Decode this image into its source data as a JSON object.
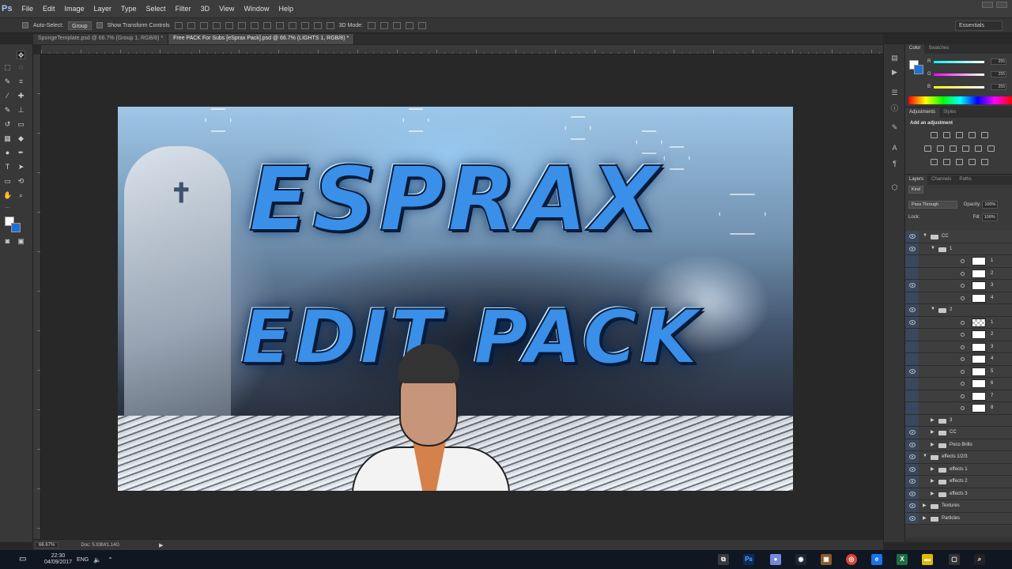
{
  "app": {
    "logo": "Ps",
    "menu": [
      "File",
      "Edit",
      "Image",
      "Layer",
      "Type",
      "Select",
      "Filter",
      "3D",
      "View",
      "Window",
      "Help"
    ],
    "workspace": "Essentials"
  },
  "options": {
    "auto_select_label": "Auto-Select:",
    "auto_select_value": "Group",
    "transform_label": "Show Transform Controls",
    "mode_3d": "3D Mode:"
  },
  "tabs": [
    {
      "label": "SpongeTemplate.psd @ 66.7% (Group 1, RGB/8) *",
      "active": false
    },
    {
      "label": "Free PACK For Subs [eSprax Pack].psd @ 66.7% (LIGHTS 1, RGB/8) *",
      "active": true
    }
  ],
  "artwork": {
    "title_line1": "ESPRAX",
    "title_line2": "EDIT PACK"
  },
  "status": {
    "zoom": "66.67%",
    "doc": "Doc: 5.93M/1.14G"
  },
  "color_panel": {
    "tabs": [
      "Color",
      "Swatches"
    ],
    "r_label": "R",
    "g_label": "G",
    "b_label": "B",
    "r": "255",
    "g": "255",
    "b": "255"
  },
  "adjustments": {
    "tabs": [
      "Adjustments",
      "Styles"
    ],
    "title": "Add an adjustment"
  },
  "layers": {
    "tabs": [
      "Layers",
      "Channels",
      "Paths"
    ],
    "filter": "Kind",
    "blend_mode": "Pass Through",
    "opacity_label": "Opacity:",
    "opacity": "100%",
    "lock_label": "Lock:",
    "fill_label": "Fill:",
    "fill": "100%",
    "items": [
      {
        "name": "CC",
        "type": "group",
        "level": 0,
        "open": true,
        "visible": true
      },
      {
        "name": "1",
        "type": "group",
        "level": 1,
        "open": true,
        "visible": true
      },
      {
        "name": "1",
        "type": "layer",
        "level": 2,
        "visible": false
      },
      {
        "name": "2",
        "type": "layer",
        "level": 2,
        "visible": false
      },
      {
        "name": "3",
        "type": "layer",
        "level": 2,
        "visible": true
      },
      {
        "name": "4",
        "type": "layer",
        "level": 2,
        "visible": false
      },
      {
        "name": "2",
        "type": "group",
        "level": 1,
        "open": true,
        "visible": true
      },
      {
        "name": "1",
        "type": "checker",
        "level": 2,
        "visible": true
      },
      {
        "name": "2",
        "type": "layer",
        "level": 2,
        "visible": false
      },
      {
        "name": "3",
        "type": "layer",
        "level": 2,
        "visible": false
      },
      {
        "name": "4",
        "type": "layer",
        "level": 2,
        "visible": false
      },
      {
        "name": "5",
        "type": "layer",
        "level": 2,
        "visible": true
      },
      {
        "name": "6",
        "type": "layer",
        "level": 2,
        "visible": false
      },
      {
        "name": "7",
        "type": "layer",
        "level": 2,
        "visible": false
      },
      {
        "name": "8",
        "type": "layer",
        "level": 2,
        "visible": false
      },
      {
        "name": "3",
        "type": "group",
        "level": 1,
        "open": false,
        "visible": false
      },
      {
        "name": "CC",
        "type": "group",
        "level": 1,
        "open": false,
        "visible": true
      },
      {
        "name": "Poco Brillo",
        "type": "group",
        "level": 1,
        "open": false,
        "visible": true
      },
      {
        "name": "effects 1/2/3",
        "type": "group",
        "level": 0,
        "open": true,
        "visible": true
      },
      {
        "name": "effects 1",
        "type": "group",
        "level": 1,
        "open": false,
        "visible": true
      },
      {
        "name": "effects 2",
        "type": "group",
        "level": 1,
        "open": false,
        "visible": true
      },
      {
        "name": "effects 3",
        "type": "group",
        "level": 1,
        "open": false,
        "visible": true
      },
      {
        "name": "Textures",
        "type": "group",
        "level": 0,
        "open": false,
        "visible": true
      },
      {
        "name": "Particles",
        "type": "group",
        "level": 0,
        "open": false,
        "visible": true
      }
    ]
  },
  "taskbar": {
    "time": "22:30",
    "date": "04/09/2017",
    "lang": "ENG"
  }
}
